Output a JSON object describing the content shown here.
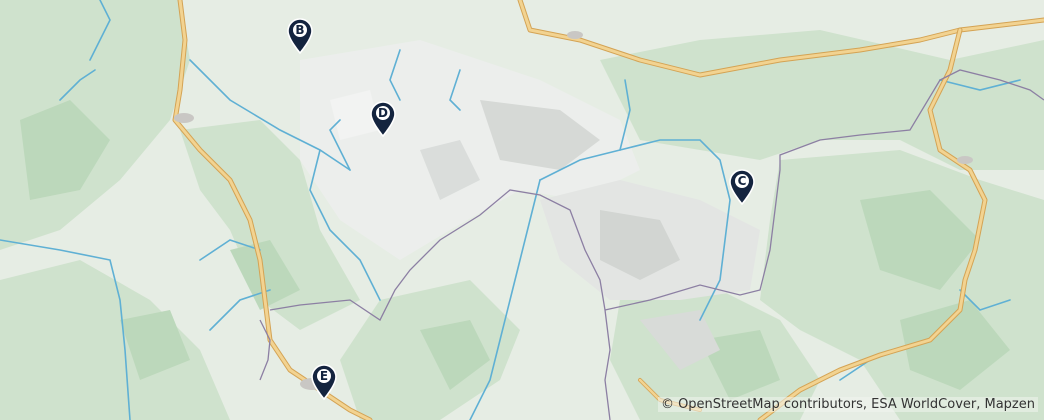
{
  "map": {
    "markers": [
      {
        "label": "B"
      },
      {
        "label": "D"
      },
      {
        "label": "C"
      },
      {
        "label": "E"
      }
    ],
    "attribution": "© OpenStreetMap contributors, ESA WorldCover, Mapzen"
  },
  "colors": {
    "background": "#e9efe7",
    "forest": "#cfe2cd",
    "forest_dark": "#bcd8bb",
    "rock": "#d9dbd8",
    "high_alpine": "#eef0ee",
    "river": "#5fb0d4",
    "road": "#f2d391",
    "road_edge": "#d4a354",
    "border": "#8c7fa3",
    "marker_fill": "#14243f",
    "marker_label_bg": "#ffffff"
  }
}
